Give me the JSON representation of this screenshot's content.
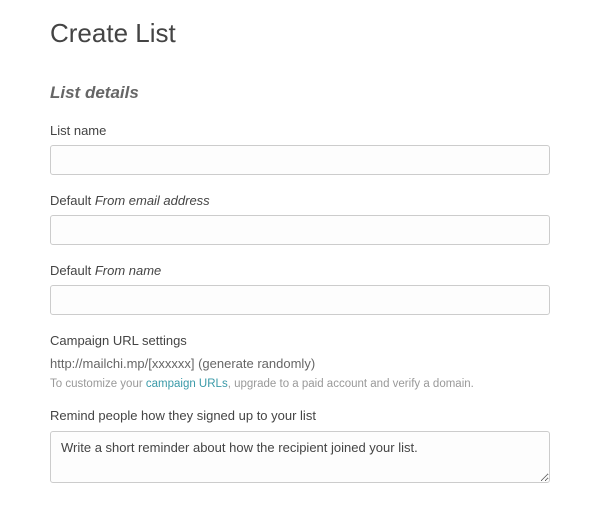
{
  "page": {
    "title": "Create List"
  },
  "section": {
    "title": "List details"
  },
  "fields": {
    "list_name": {
      "label_prefix": "List name",
      "value": ""
    },
    "from_email": {
      "label_prefix": "Default ",
      "label_em": "From email address",
      "value": ""
    },
    "from_name": {
      "label_prefix": "Default ",
      "label_em": "From name",
      "value": ""
    },
    "campaign_url": {
      "label": "Campaign URL settings",
      "url_text": "http://mailchi.mp/[xxxxxx] (generate randomly)",
      "help_prefix": "To customize your ",
      "help_link": "campaign URLs",
      "help_suffix": ", upgrade to a paid account and verify a domain."
    },
    "reminder": {
      "label": "Remind people how they signed up to your list",
      "value": "Write a short reminder about how the recipient joined your list."
    }
  }
}
